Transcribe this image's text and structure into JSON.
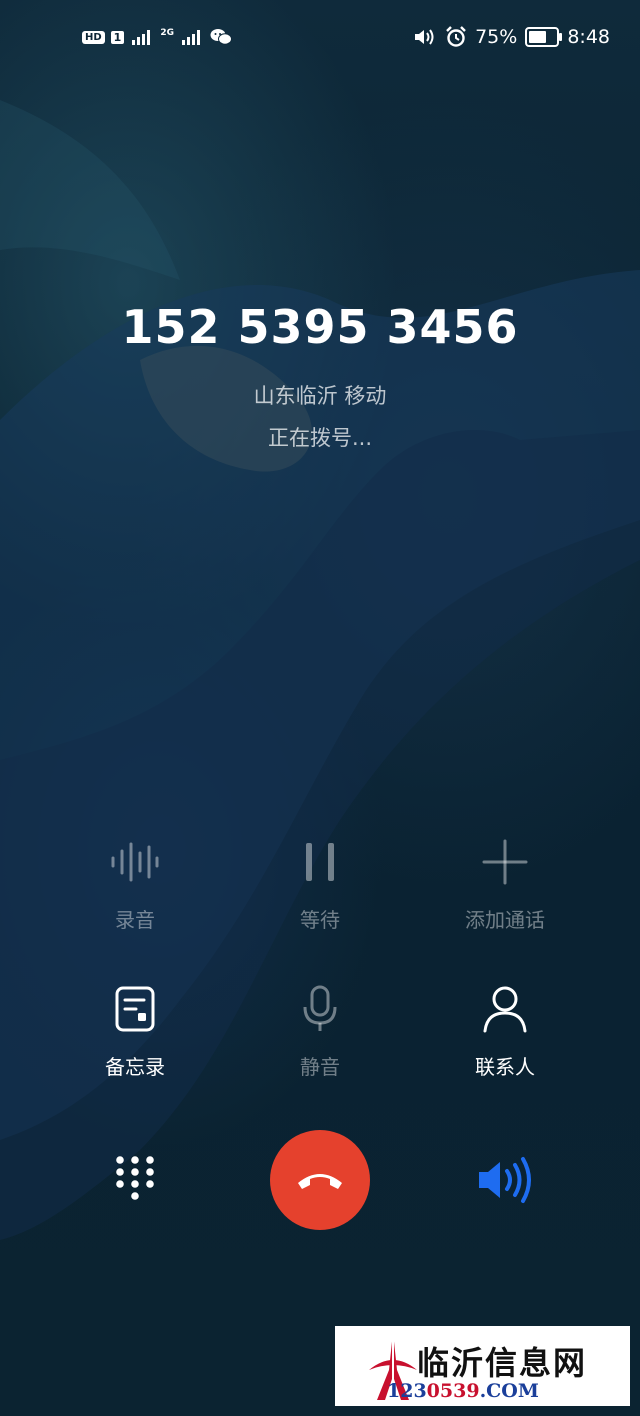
{
  "status_bar": {
    "left_icons": [
      "hd-icon",
      "sim1-signal-icon",
      "sim2-signal-icon",
      "wechat-icon"
    ],
    "hd_label": "HD",
    "sim1_label": "1",
    "sim2_network": "2G",
    "battery_percent": "75%",
    "battery_level": 0.75,
    "time": "8:48"
  },
  "caller": {
    "number": "152 5395 3456",
    "location": "山东临沂 移动",
    "status": "正在拨号..."
  },
  "controls": {
    "record": "录音",
    "hold": "等待",
    "add_call": "添加通话",
    "notes": "备忘录",
    "mute": "静音",
    "contacts": "联系人"
  },
  "colors": {
    "end_call": "#e5412d",
    "speaker_active": "#1e6cf0",
    "background": "#0b2433"
  },
  "watermark": {
    "site_name": "临沂信息网",
    "url_part1": "123",
    "url_part2": "0539",
    "url_part3": ".COM"
  }
}
